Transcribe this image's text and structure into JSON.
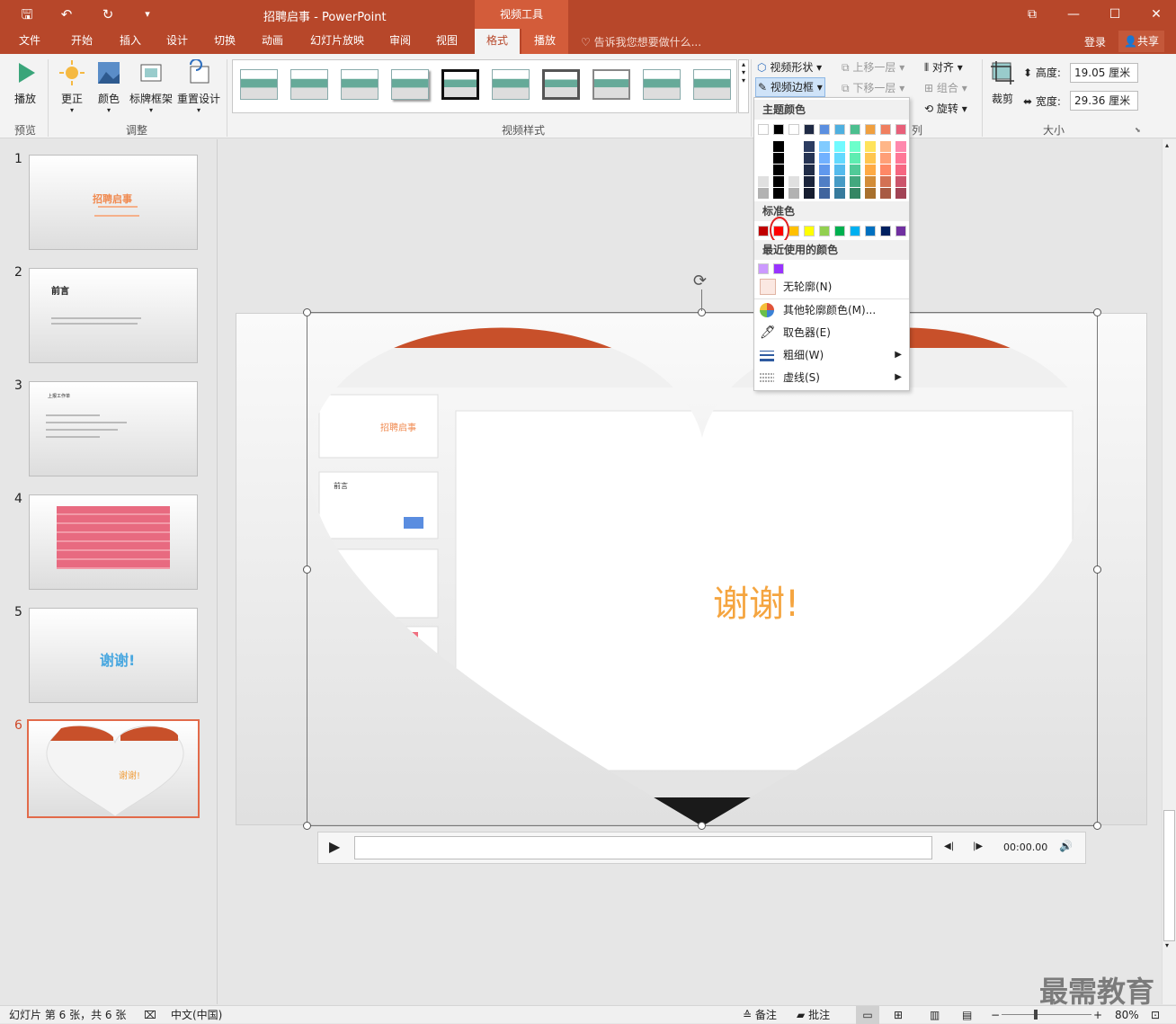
{
  "titlebar": {
    "title": "招聘启事 - PowerPoint",
    "context_tools": "视频工具",
    "qa_save": "🖫",
    "qa_undo": "↶",
    "qa_redo": "↻",
    "qa_customize": "▾",
    "win_ribbon": "⧉",
    "win_min": "—",
    "win_max": "☐",
    "win_close": "✕"
  },
  "tabs": [
    {
      "label": "文件"
    },
    {
      "label": "开始"
    },
    {
      "label": "插入"
    },
    {
      "label": "设计"
    },
    {
      "label": "切换"
    },
    {
      "label": "动画"
    },
    {
      "label": "幻灯片放映"
    },
    {
      "label": "审阅"
    },
    {
      "label": "视图"
    },
    {
      "label": "格式"
    },
    {
      "label": "播放"
    }
  ],
  "tellme": "告诉我您想要做什么...",
  "login": "登录",
  "share": "共享",
  "ribbon": {
    "preview": {
      "play": "播放",
      "group": "预览"
    },
    "adjust": {
      "correct": "更正",
      "color": "颜色",
      "poster": "标牌框架",
      "reset": "重置设计",
      "group": "调整"
    },
    "styles_group": "视频样式",
    "video_shape": "视频形状",
    "video_border": "视频边框",
    "arrange": {
      "bring_forward": "上移一层",
      "send_backward": "下移一层",
      "align": "对齐",
      "group": "组合",
      "rotate": "旋转",
      "group_label_tail": "列"
    },
    "size": {
      "crop": "裁剪",
      "height_label": "高度:",
      "height_value": "19.05 厘米",
      "width_label": "宽度:",
      "width_value": "29.36 厘米",
      "group": "大小"
    }
  },
  "slides": [
    {
      "num": "1",
      "title": "招聘启事"
    },
    {
      "num": "2",
      "title": "前言"
    },
    {
      "num": "3",
      "title": "上报工作单"
    },
    {
      "num": "4",
      "title": ""
    },
    {
      "num": "5",
      "title": "谢谢!"
    },
    {
      "num": "6",
      "title": "谢谢!"
    }
  ],
  "slide_main": {
    "thanks": "谢谢!",
    "inner_thumb1": "招聘启事",
    "inner_thumb2": "前言"
  },
  "player": {
    "play": "▶",
    "back": "◀|",
    "fwd": "|▶",
    "time": "00:00.00",
    "volume": "🔊"
  },
  "dropdown": {
    "theme_colors": "主题颜色",
    "standard_colors": "标准色",
    "recent_colors": "最近使用的颜色",
    "no_outline": "无轮廓(N)",
    "more_colors": "其他轮廓颜色(M)...",
    "eyedropper": "取色器(E)",
    "weight": "粗细(W)",
    "dashes": "虚线(S)",
    "theme_row": [
      "#ffffff",
      "#000000",
      "#ffffff",
      "#1f2a44",
      "#5b8fe0",
      "#4fb0e0",
      "#4cbf8f",
      "#f0a040",
      "#f08060",
      "#e8607a"
    ],
    "standard_row": [
      "#c00000",
      "#ff0000",
      "#ffc000",
      "#ffff00",
      "#92d050",
      "#00b050",
      "#00b0f0",
      "#0070c0",
      "#002060",
      "#7030a0"
    ],
    "recent_row": [
      "#cc99ff",
      "#9933ff"
    ]
  },
  "statusbar": {
    "slide_info": "幻灯片 第 6 张，共 6 张",
    "language": "中文(中国)",
    "notes": "备注",
    "comments": "批注",
    "zoom": "80%"
  },
  "watermark": "最需教育"
}
